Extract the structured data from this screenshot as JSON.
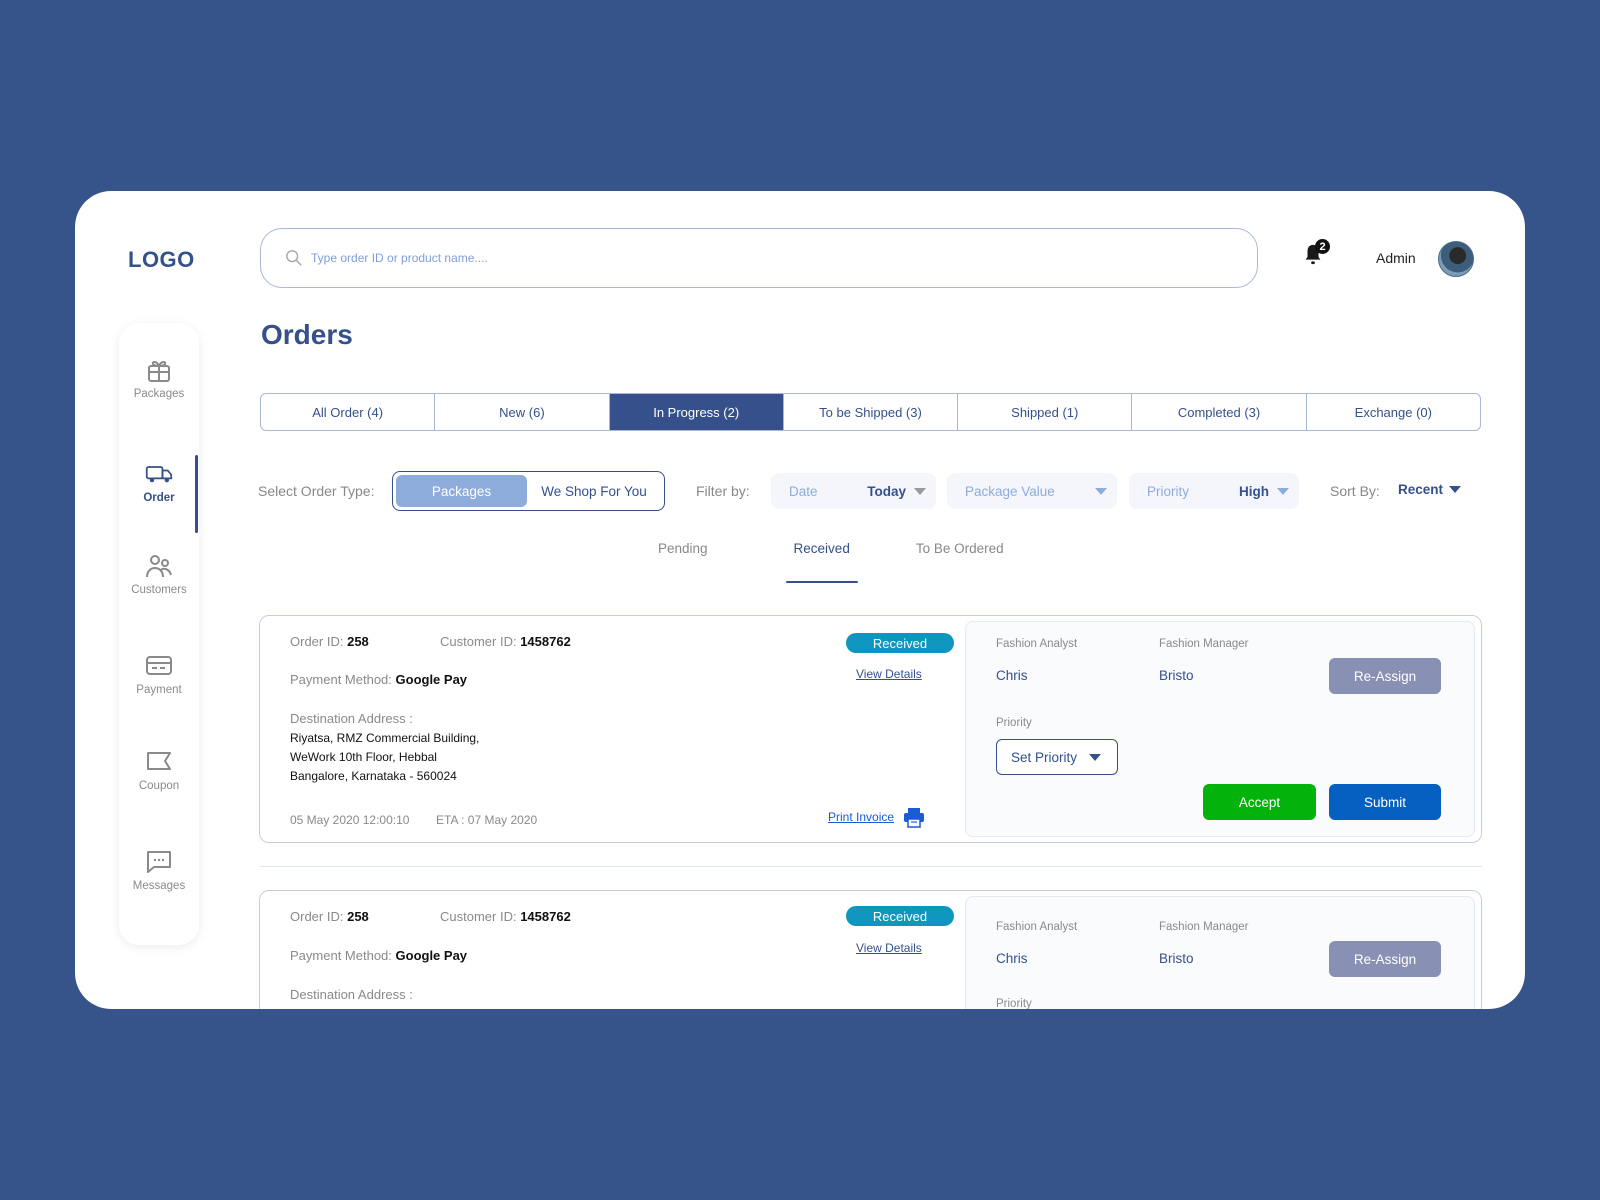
{
  "app": {
    "logo": "LOGO",
    "search_placeholder": "Type order ID or product name....",
    "notifications_count": "2",
    "user_name": "Admin"
  },
  "sidebar": {
    "items": [
      {
        "label": "Packages",
        "icon": "gift-icon",
        "active": false
      },
      {
        "label": "Order",
        "icon": "truck-icon",
        "active": true
      },
      {
        "label": "Customers",
        "icon": "users-icon",
        "active": false
      },
      {
        "label": "Payment",
        "icon": "credit-card-icon",
        "active": false
      },
      {
        "label": "Coupon",
        "icon": "coupon-icon",
        "active": false
      },
      {
        "label": "Messages",
        "icon": "message-icon",
        "active": false
      }
    ]
  },
  "page": {
    "title": "Orders",
    "tabs": [
      {
        "label": "All Order (4)"
      },
      {
        "label": "New (6)"
      },
      {
        "label": "In Progress (2)",
        "active": true
      },
      {
        "label": "To be Shipped (3)"
      },
      {
        "label": "Shipped (1)"
      },
      {
        "label": "Completed (3)"
      },
      {
        "label": "Exchange (0)"
      }
    ]
  },
  "filters": {
    "order_type_label": "Select Order Type:",
    "order_types": [
      "Packages",
      "We Shop For You"
    ],
    "order_type_selected": "Packages",
    "filter_by_label": "Filter by:",
    "date": {
      "label": "Date",
      "value": "Today"
    },
    "package_value": {
      "label": "Package Value",
      "value": ""
    },
    "priority": {
      "label": "Priority",
      "value": "High"
    },
    "sort_by_label": "Sort By:",
    "sort_by_value": "Recent"
  },
  "subtabs": {
    "items": [
      "Pending",
      "Received",
      "To Be Ordered"
    ],
    "active": "Received"
  },
  "orders": [
    {
      "order_id_label": "Order ID:",
      "order_id": "258",
      "customer_id_label": "Customer ID:",
      "customer_id": "1458762",
      "status": "Received",
      "view_details": "View Details",
      "payment_label": "Payment Method:",
      "payment_method": "Google Pay",
      "address_label": "Destination Address :",
      "address_lines": [
        "Riyatsa, RMZ Commercial Building,",
        "WeWork 10th Floor, Hebbal",
        "Bangalore, Karnataka - 560024"
      ],
      "date": "05 May 2020  12:00:10",
      "eta": "ETA : 07 May 2020",
      "print_invoice": "Print Invoice",
      "analyst_label": "Fashion Analyst",
      "analyst": "Chris",
      "manager_label": "Fashion Manager",
      "manager": "Bristo",
      "reassign": "Re-Assign",
      "priority_label": "Priority",
      "set_priority": "Set Priority",
      "accept": "Accept",
      "submit": "Submit"
    },
    {
      "order_id_label": "Order ID:",
      "order_id": "258",
      "customer_id_label": "Customer ID:",
      "customer_id": "1458762",
      "status": "Received",
      "view_details": "View Details",
      "payment_label": "Payment Method:",
      "payment_method": "Google Pay",
      "address_label": "Destination Address :",
      "analyst_label": "Fashion Analyst",
      "analyst": "Chris",
      "manager_label": "Fashion Manager",
      "manager": "Bristo",
      "reassign": "Re-Assign",
      "priority_label": "Priority"
    }
  ],
  "colors": {
    "brand": "#35508a",
    "status_received": "#0f96bf",
    "accept": "#03b30c",
    "submit": "#0660c2",
    "reassign": "#8890b3"
  }
}
